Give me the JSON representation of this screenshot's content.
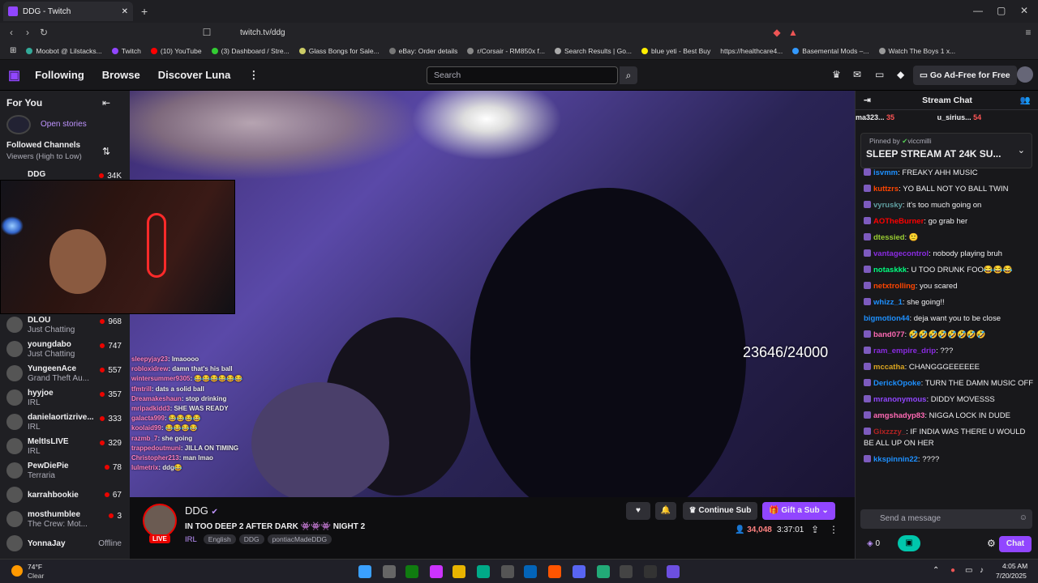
{
  "browser": {
    "tab_title": "DDG - Twitch",
    "url": "twitch.tv/ddg",
    "bookmarks": [
      "Moobot @ Lilstacks...",
      "Twitch",
      "(10) YouTube",
      "(3) Dashboard / Stre...",
      "Glass Bongs for Sale...",
      "eBay: Order details",
      "r/Corsair - RM850x f...",
      "Search Results | Go...",
      "blue yeti - Best Buy",
      "https://healthcare4...",
      "Basemental Mods –...",
      "Watch The Boys 1 x..."
    ]
  },
  "nav": {
    "following": "Following",
    "browse": "Browse",
    "discover": "Discover Luna",
    "search_placeholder": "Search",
    "ad_free": "Go Ad-Free for Free"
  },
  "sidebar": {
    "for_you": "For You",
    "open_stories": "Open stories",
    "followed": "Followed Channels",
    "sort": "Viewers (High to Low)",
    "top": {
      "name": "DDG",
      "viewers": "34K"
    },
    "channels": [
      {
        "name": "DLOU",
        "game": "Just Chatting",
        "viewers": "968"
      },
      {
        "name": "youngdabo",
        "game": "Just Chatting",
        "viewers": "747"
      },
      {
        "name": "YungeenAce",
        "game": "Grand Theft Au...",
        "viewers": "557"
      },
      {
        "name": "hyyjoe",
        "game": "IRL",
        "viewers": "357"
      },
      {
        "name": "danielaortizrive...",
        "game": "IRL",
        "viewers": "333"
      },
      {
        "name": "MeltIsLIVE",
        "game": "IRL",
        "viewers": "329"
      },
      {
        "name": "PewDiePie",
        "game": "Terraria",
        "viewers": "78"
      },
      {
        "name": "karrahbookie",
        "game": "",
        "viewers": "67"
      },
      {
        "name": "mosthumblee",
        "game": "The Crew: Mot...",
        "viewers": "3"
      },
      {
        "name": "YonnaJay",
        "game": "",
        "viewers": "Offline"
      }
    ]
  },
  "video": {
    "counter": "23646/24000",
    "overlay_chat": [
      {
        "u": "sleepyjay23",
        "t": "lmaoooo"
      },
      {
        "u": "robloxidrew",
        "t": "damn that's his ball"
      },
      {
        "u": "wintersummer9305",
        "t": "😂😂😂😂😂😂"
      },
      {
        "u": "tfmtrill",
        "t": "dats a solid ball"
      },
      {
        "u": "Dreamakeshaun",
        "t": "stop drinking"
      },
      {
        "u": "mripadkidd3",
        "t": "SHE WAS READY"
      },
      {
        "u": "galacta999",
        "t": "😂😂😂😂"
      },
      {
        "u": "koolaid99",
        "t": "😂😂😂😂"
      },
      {
        "u": "razmb_7",
        "t": "she going"
      },
      {
        "u": "trappedoutmuni",
        "t": "JILLA ON TIMING"
      },
      {
        "u": "Christopher213",
        "t": "man lmao"
      },
      {
        "u": "lulmetrix",
        "t": "ddg😂"
      }
    ]
  },
  "channel": {
    "name": "DDG",
    "live": "LIVE",
    "title": "IN TOO DEEP 2 AFTER DARK 👾👾👾 NIGHT 2",
    "tags": [
      "IRL",
      "English",
      "DDG",
      "pontiacMadeDDG"
    ],
    "continue_sub": "Continue Sub",
    "gift_sub": "Gift a Sub",
    "viewers": "34,048",
    "uptime": "3:37:01"
  },
  "chat": {
    "header": "Stream Chat",
    "top_gifters": [
      {
        "name": "ma323...",
        "count": "35"
      },
      {
        "name": "u_sirius...",
        "count": "54"
      }
    ],
    "pinned_by": "Pinned by",
    "pinned_user": "viccmilli",
    "pinned_text": "SLEEP STREAM AT 24K SU...",
    "messages": [
      {
        "u": "isvmm",
        "c": "#1e90ff",
        "t": "FREAKY AHH MUSIC"
      },
      {
        "u": "kuttzrs",
        "c": "#ff4500",
        "t": "YO BALL NOT YO BALL TWIN"
      },
      {
        "u": "vyrusky",
        "c": "#5f9ea0",
        "t": "it's too much going on"
      },
      {
        "u": "AOTheBurner",
        "c": "#ff0000",
        "t": "go grab her"
      },
      {
        "u": "dtessied",
        "c": "#9acd32",
        "t": "🙂"
      },
      {
        "u": "vantagecontrol",
        "c": "#8a2be2",
        "t": "nobody playing bruh"
      },
      {
        "u": "notaskkk",
        "c": "#00ff7f",
        "t": "U TOO DRUNK FOO😂😂😂"
      },
      {
        "u": "netxtrolling",
        "c": "#ff4500",
        "t": "you scared"
      },
      {
        "u": "whizz_1",
        "c": "#1e90ff",
        "t": "she going!!"
      },
      {
        "u": "bigmotion44",
        "c": "#1e90ff",
        "t": "deja want you to be close"
      },
      {
        "u": "band077",
        "c": "#ff69b4",
        "t": "🤣🤣🤣🤣🤣🤣🤣🤣"
      },
      {
        "u": "ram_empire_drip",
        "c": "#8a2be2",
        "t": "???"
      },
      {
        "u": "mccatha",
        "c": "#daa520",
        "t": "CHANGGGEEEEEE"
      },
      {
        "u": "DerickOpoke",
        "c": "#1e90ff",
        "t": "TURN THE DAMN MUSIC OFF"
      },
      {
        "u": "mranonymous",
        "c": "#9146ff",
        "t": "DIDDY MOVESSS"
      },
      {
        "u": "amgshadyp83",
        "c": "#ff69b4",
        "t": "NIGGA LOCK IN DUDE"
      },
      {
        "u": "Gixzzzy_",
        "c": "#b22222",
        "t": "IF INDIA WAS THERE U WOULD BE ALL UP ON HER"
      },
      {
        "u": "kkspinnin22",
        "c": "#1e90ff",
        "t": "????"
      }
    ],
    "send_placeholder": "Send a message",
    "points": "0",
    "chat_button": "Chat"
  },
  "taskbar": {
    "weather_temp": "74°F",
    "weather_desc": "Clear",
    "time": "4:05 AM",
    "date": "7/20/2025"
  }
}
